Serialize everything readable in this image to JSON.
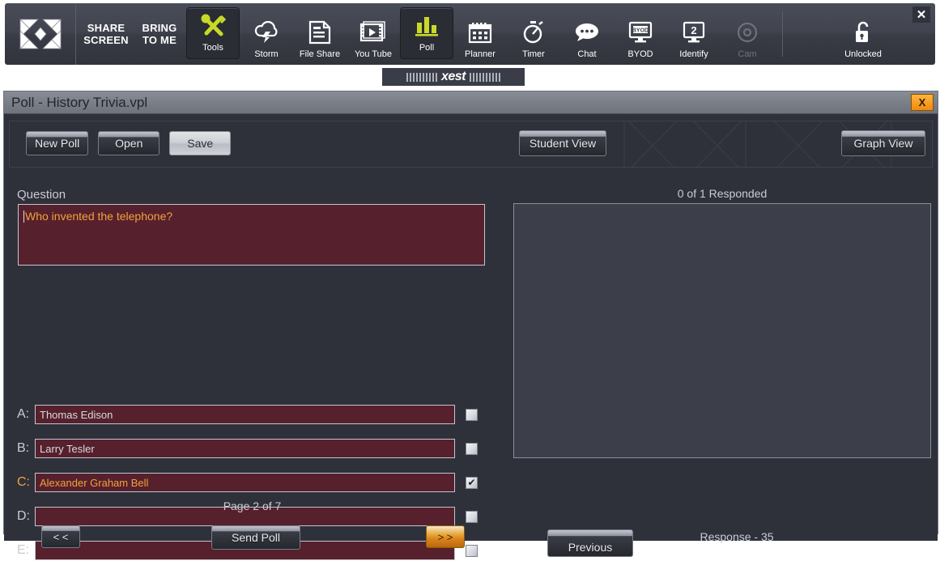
{
  "app_bar": {
    "logo": "x-logo",
    "text_tiles": [
      {
        "line1": "SHARE",
        "line2": "SCREEN",
        "name": "share-screen"
      },
      {
        "line1": "BRING",
        "line2": "TO ME",
        "name": "bring-to-me"
      }
    ],
    "tools": [
      {
        "label": "Tools",
        "icon": "tools-icon",
        "active": true,
        "dimmed": false
      },
      {
        "label": "Storm",
        "icon": "storm-icon",
        "active": false,
        "dimmed": false
      },
      {
        "label": "File Share",
        "icon": "file-share-icon",
        "active": false,
        "dimmed": false
      },
      {
        "label": "You Tube",
        "icon": "youtube-icon",
        "active": false,
        "dimmed": false
      },
      {
        "label": "Poll",
        "icon": "poll-icon",
        "active": true,
        "dimmed": false
      },
      {
        "label": "Planner",
        "icon": "planner-icon",
        "active": false,
        "dimmed": false
      },
      {
        "label": "Timer",
        "icon": "timer-icon",
        "active": false,
        "dimmed": false
      },
      {
        "label": "Chat",
        "icon": "chat-icon",
        "active": false,
        "dimmed": false
      },
      {
        "label": "BYOD",
        "icon": "byod-icon",
        "active": false,
        "dimmed": false
      },
      {
        "label": "Identify",
        "icon": "identify-icon",
        "active": false,
        "dimmed": false
      },
      {
        "label": "Cam",
        "icon": "cam-icon",
        "active": false,
        "dimmed": true
      }
    ],
    "lock": {
      "label": "Unlocked",
      "icon": "unlocked-padlock-icon"
    },
    "close_label": "✕",
    "accent_color": "#c8d927"
  },
  "xest_tab": {
    "title": "xest"
  },
  "window": {
    "title": "Poll - History Trivia.vpl",
    "close_label": "X",
    "close_color": "#f0920f"
  },
  "toolbar": {
    "new_poll": "New Poll",
    "open": "Open",
    "save": "Save",
    "student_view": "Student View",
    "graph_view": "Graph View"
  },
  "question": {
    "label": "Question",
    "text": "Who invented the telephone?",
    "text_color": "#f0a23c",
    "field_color": "#56202c"
  },
  "answers": [
    {
      "letter": "A:",
      "text": "Thomas Edison",
      "checked": false,
      "correct": false
    },
    {
      "letter": "B:",
      "text": "Larry Tesler",
      "checked": false,
      "correct": false
    },
    {
      "letter": "C:",
      "text": "Alexander Graham Bell",
      "checked": true,
      "correct": true
    },
    {
      "letter": "D:",
      "text": "",
      "checked": false,
      "correct": false
    },
    {
      "letter": "E:",
      "text": "",
      "checked": false,
      "correct": false
    }
  ],
  "checkbox_glyph": "✔",
  "footer": {
    "page_label": "Page 2 of 7",
    "prev_label": "< <",
    "send_label": "Send Poll",
    "next_label": "> >"
  },
  "responses": {
    "responded_label": "0 of 1 Responded",
    "previous_label": "Previous",
    "response_label": "Response - 35"
  }
}
